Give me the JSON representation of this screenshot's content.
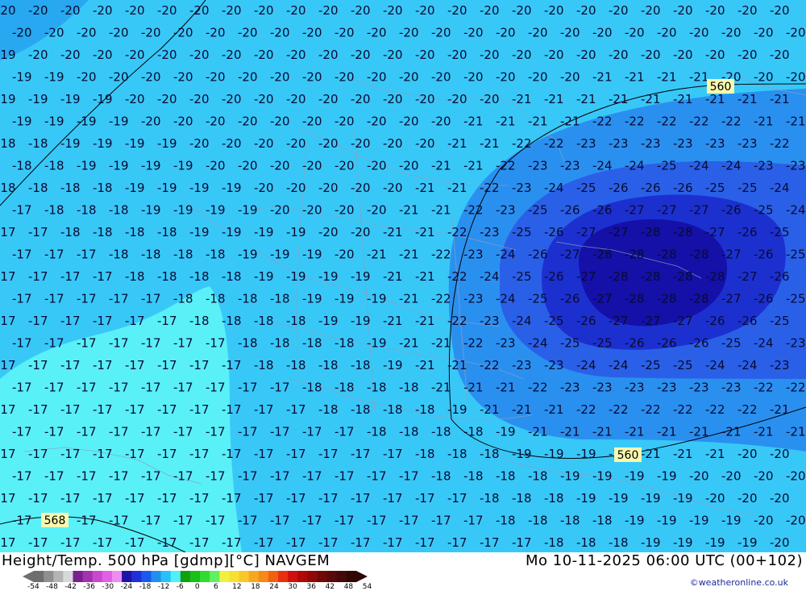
{
  "map": {
    "contour_labels": [
      "560",
      "560",
      "568"
    ],
    "temperature_levels": [
      "-28",
      "-27",
      "-26",
      "-25",
      "-24",
      "-23",
      "-22",
      "-21",
      "-20",
      "-19",
      "-18",
      "-17"
    ]
  },
  "footer": {
    "title_left": "Height/Temp. 500 hPa [gdmp][°C] NAVGEM",
    "title_right": "Mo 10-11-2025 06:00 UTC (00+102)",
    "credit": "©weatheronline.co.uk",
    "scale_labels": [
      "-54",
      "-48",
      "-42",
      "-36",
      "-30",
      "-24",
      "-18",
      "-12",
      "-6",
      "0",
      "6",
      "12",
      "18",
      "24",
      "30",
      "36",
      "42",
      "48",
      "54"
    ],
    "scale_colors": [
      "#6e6e6e",
      "#8f8f8f",
      "#b4b4b4",
      "#d8d8d8",
      "#7a1f8f",
      "#a232b0",
      "#c848d2",
      "#e35fe3",
      "#f08bf0",
      "#1c14a8",
      "#2030d8",
      "#1a58f0",
      "#1f90f0",
      "#28c0f8",
      "#50f0f8",
      "#10a010",
      "#18c018",
      "#30dc30",
      "#60f060",
      "#f0f040",
      "#f8e030",
      "#f8c828",
      "#f8a820",
      "#f88818",
      "#f06010",
      "#e83010",
      "#d01010",
      "#b00808",
      "#900808",
      "#700808",
      "#580a0a",
      "#440808",
      "#300606"
    ]
  }
}
